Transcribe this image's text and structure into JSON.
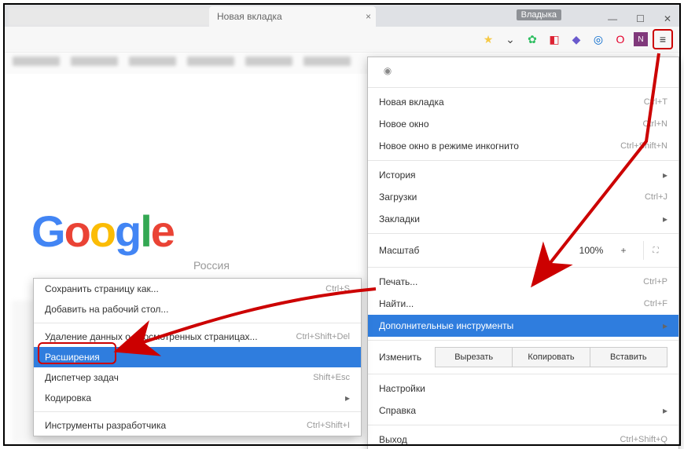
{
  "tabs": {
    "active_label": "Новая вкладка"
  },
  "profile_chip": "Владыка",
  "logo_letters": [
    "G",
    "o",
    "o",
    "g",
    "l",
    "e"
  ],
  "logo_sub": "Россия",
  "menu": {
    "new_tab": {
      "label": "Новая вкладка",
      "shortcut": "Ctrl+T"
    },
    "new_window": {
      "label": "Новое окно",
      "shortcut": "Ctrl+N"
    },
    "incognito": {
      "label": "Новое окно в режиме инкогнито",
      "shortcut": "Ctrl+Shift+N"
    },
    "history": {
      "label": "История"
    },
    "downloads": {
      "label": "Загрузки",
      "shortcut": "Ctrl+J"
    },
    "bookmarks": {
      "label": "Закладки"
    },
    "zoom": {
      "label": "Масштаб",
      "minus": "-",
      "value": "100%",
      "plus": "+"
    },
    "print": {
      "label": "Печать...",
      "shortcut": "Ctrl+P"
    },
    "find": {
      "label": "Найти...",
      "shortcut": "Ctrl+F"
    },
    "more_tools": {
      "label": "Дополнительные инструменты"
    },
    "edit": {
      "label": "Изменить",
      "cut": "Вырезать",
      "copy": "Копировать",
      "paste": "Вставить"
    },
    "settings": {
      "label": "Настройки"
    },
    "help": {
      "label": "Справка"
    },
    "exit": {
      "label": "Выход",
      "shortcut": "Ctrl+Shift+Q"
    }
  },
  "submenu": {
    "save_as": {
      "label": "Сохранить страницу как...",
      "shortcut": "Ctrl+S"
    },
    "add_desktop": {
      "label": "Добавить на рабочий стол..."
    },
    "clear_data": {
      "label": "Удаление данных о просмотренных страницах...",
      "shortcut": "Ctrl+Shift+Del"
    },
    "extensions": {
      "label": "Расширения"
    },
    "task_mgr": {
      "label": "Диспетчер задач",
      "shortcut": "Shift+Esc"
    },
    "encoding": {
      "label": "Кодировка"
    },
    "devtools": {
      "label": "Инструменты разработчика",
      "shortcut": "Ctrl+Shift+I"
    }
  }
}
